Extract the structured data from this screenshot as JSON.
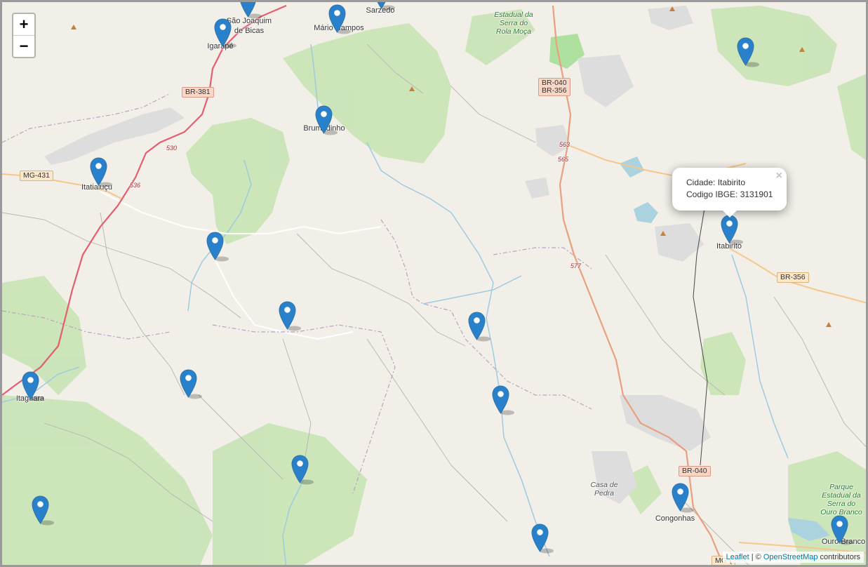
{
  "map": {
    "zoom_in_label": "+",
    "zoom_out_label": "−",
    "popup": {
      "city_line": "Cidade: Itabirito",
      "ibge_line": "Codigo IBGE: 3131901",
      "close_label": "×"
    },
    "attribution": {
      "leaflet": "Leaflet",
      "separator": " | © ",
      "osm": "OpenStreetMap",
      "suffix": " contributors"
    },
    "places": [
      {
        "name": "São Joaquim"
      },
      {
        "name": "de Bicas"
      },
      {
        "name": "Igarapé"
      },
      {
        "name": "Mário Campos"
      },
      {
        "name": "Sarzedo"
      },
      {
        "name": "Brumadinho"
      },
      {
        "name": "Itatiaiuçu"
      },
      {
        "name": "Itabirito"
      },
      {
        "name": "Itaguara"
      },
      {
        "name": "Congonhas"
      },
      {
        "name": "Ouro Branco"
      },
      {
        "name": "Casa de Pedra"
      }
    ],
    "parks": [
      {
        "name": "Estadual da Serra do Rola Moça"
      },
      {
        "name": "Parque Estadual da Serra do Ouro Branco"
      }
    ],
    "road_shields": [
      {
        "label": "BR-381"
      },
      {
        "label": "BR-040"
      },
      {
        "label": "BR-356"
      },
      {
        "label": "MG-431"
      },
      {
        "label": "BR-356"
      },
      {
        "label": "BR-040"
      },
      {
        "label": "MG-("
      }
    ],
    "road_numbers": [
      "530",
      "536",
      "563",
      "565",
      "577"
    ],
    "marker_color": "#2a81cb",
    "background_color": "#f2efe9"
  }
}
